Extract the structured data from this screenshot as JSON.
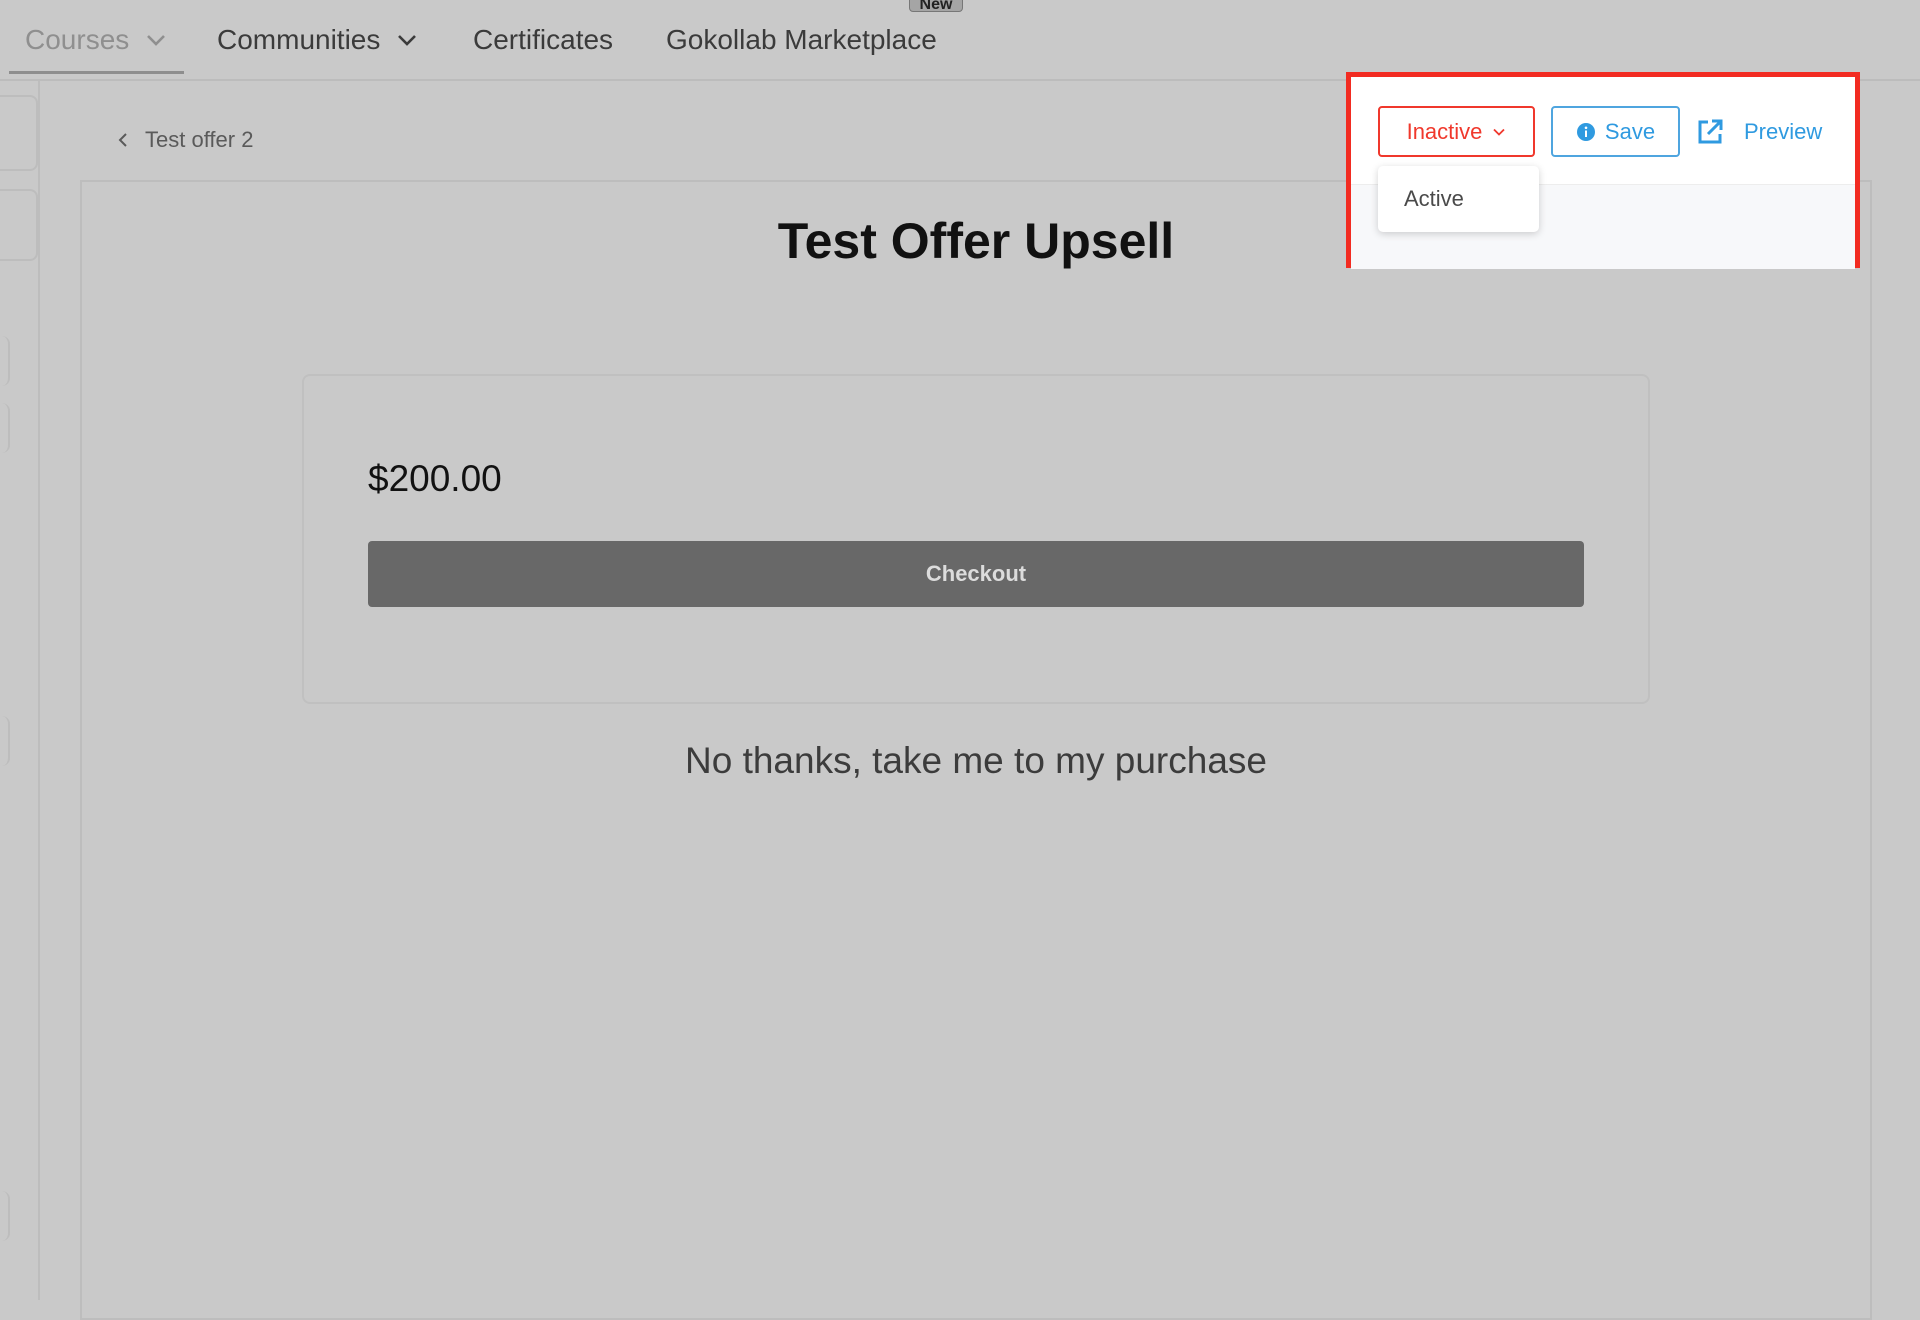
{
  "nav": {
    "items": [
      {
        "label": "Courses",
        "has_dropdown": true,
        "active": true
      },
      {
        "label": "Communities",
        "has_dropdown": true,
        "active": false
      },
      {
        "label": "Certificates",
        "has_dropdown": false,
        "active": false
      },
      {
        "label": "Gokollab Marketplace",
        "has_dropdown": false,
        "active": false
      }
    ],
    "badge": "New"
  },
  "breadcrumb": {
    "back_label": "Test offer 2",
    "icon": "chevron-left-icon"
  },
  "toolbar": {
    "status_value": "Inactive",
    "status_options": [
      "Active"
    ],
    "save_label": "Save",
    "preview_label": "Preview",
    "icons": {
      "status": "chevron-down-icon",
      "save": "info-icon",
      "preview": "external-link-icon"
    }
  },
  "offer": {
    "title": "Test Offer Upsell",
    "price": "$200.00",
    "checkout_label": "Checkout",
    "decline_label": "No thanks, take me to my purchase"
  },
  "colors": {
    "accent_blue": "#2f9ae0",
    "status_red": "#f0382c",
    "highlight_red": "#f22b21",
    "overlay_gray": "#c9c9c9",
    "checkout_gray": "#686868"
  }
}
